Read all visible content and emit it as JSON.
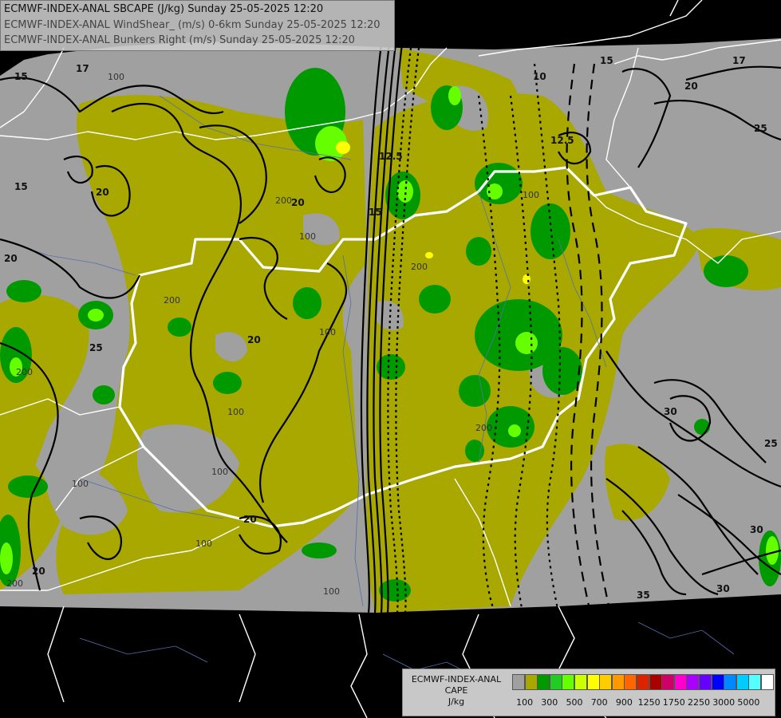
{
  "title_lines": [
    "ECMWF-INDEX-ANAL SBCAPE (J/kg) Sunday 25-05-2025 12:20",
    "ECMWF-INDEX-ANAL WindShear_ (m/s) 0-6km Sunday 25-05-2025 12:20",
    "ECMWF-INDEX-ANAL Bunkers Right (m/s) Sunday 25-05-2025 12:20"
  ],
  "legend": {
    "title_lines": [
      "ECMWF-INDEX-ANAL",
      "CAPE",
      "J/kg"
    ],
    "colors": [
      "#a0a0a0",
      "#a8a800",
      "#009900",
      "#22cc22",
      "#66ff00",
      "#ccff00",
      "#ffff00",
      "#ffcc00",
      "#ff9900",
      "#ff6600",
      "#dd2200",
      "#aa0000",
      "#cc0066",
      "#ff00cc",
      "#aa00ff",
      "#6600ff",
      "#0000ff",
      "#0088ff",
      "#00ccff",
      "#55ffff",
      "#ffffff"
    ],
    "ticks": [
      "100",
      "300",
      "500",
      "700",
      "900",
      "1250",
      "1750",
      "2250",
      "3000",
      "5000"
    ]
  },
  "contour_labels": [
    {
      "text": "15"
    },
    {
      "text": "17"
    },
    {
      "text": "100"
    },
    {
      "text": "20"
    },
    {
      "text": "12.5"
    },
    {
      "text": "10"
    },
    {
      "text": "15"
    },
    {
      "text": "17"
    },
    {
      "text": "20"
    },
    {
      "text": "25"
    },
    {
      "text": "15"
    },
    {
      "text": "20"
    },
    {
      "text": "20"
    },
    {
      "text": "200"
    },
    {
      "text": "100"
    },
    {
      "text": "100"
    },
    {
      "text": "25"
    },
    {
      "text": "200"
    },
    {
      "text": "100"
    },
    {
      "text": "200"
    },
    {
      "text": "20"
    },
    {
      "text": "100"
    },
    {
      "text": "100"
    },
    {
      "text": "200"
    },
    {
      "text": "30"
    },
    {
      "text": "25"
    },
    {
      "text": "100"
    },
    {
      "text": "200"
    },
    {
      "text": "20"
    },
    {
      "text": "100"
    },
    {
      "text": "30"
    },
    {
      "text": "35"
    },
    {
      "text": "30"
    },
    {
      "text": "20"
    },
    {
      "text": "200"
    },
    {
      "text": "100"
    },
    {
      "text": "12.5"
    },
    {
      "text": "15"
    }
  ]
}
